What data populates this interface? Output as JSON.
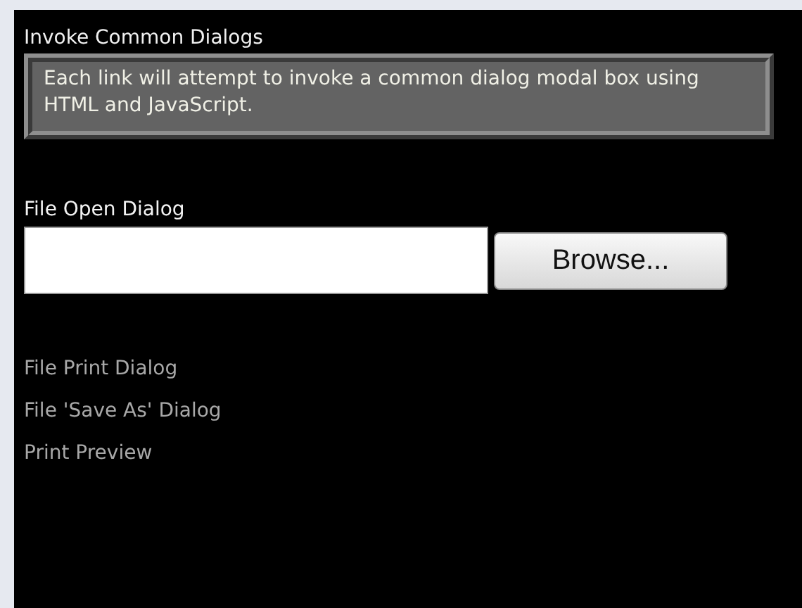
{
  "section": {
    "title": "Invoke Common Dialogs",
    "description": "Each link will attempt to invoke a common dialog modal box using HTML and JavaScript."
  },
  "file_open": {
    "label": "File Open Dialog",
    "button": "Browse..."
  },
  "links": [
    "File Print Dialog",
    "File 'Save As' Dialog",
    "Print Preview"
  ]
}
